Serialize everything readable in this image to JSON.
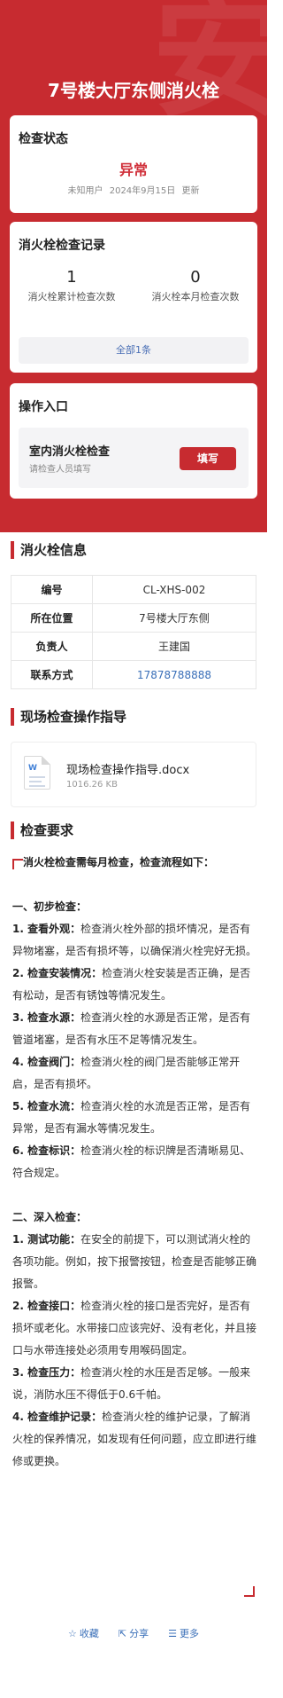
{
  "page": {
    "title": "7号楼大厅东侧消火栓"
  },
  "status": {
    "title": "检查状态",
    "value": "异常",
    "user": "未知用户",
    "date": "2024年9月15日",
    "suffix": "更新"
  },
  "records": {
    "title": "消火栓检查记录",
    "total_count": "1",
    "total_label": "消火栓累计检查次数",
    "month_count": "0",
    "month_label": "消火栓本月检查次数",
    "all_label": "全部1条"
  },
  "actions": {
    "title": "操作入口",
    "item_name": "室内消火栓检查",
    "item_sub": "请检查人员填写",
    "button": "填写"
  },
  "info": {
    "title": "消火栓信息",
    "rows": [
      {
        "key": "编号",
        "value": "CL-XHS-002"
      },
      {
        "key": "所在位置",
        "value": "7号楼大厅东侧"
      },
      {
        "key": "负责人",
        "value": "王建国"
      },
      {
        "key": "联系方式",
        "value": "17878788888"
      }
    ]
  },
  "guide": {
    "title": "现场检查操作指导",
    "file_name": "现场检查操作指导.docx",
    "file_size": "1016.26 KB",
    "file_icon": "word-document-icon"
  },
  "requirements": {
    "title": "检查要求",
    "intro": "消火栓检查需每月检查，检查流程如下：",
    "section1": "一、初步检查：",
    "items1": [
      {
        "label": "1. 查看外观：",
        "text": "检查消火栓外部的损坏情况，是否有异物堵塞，是否有损坏等，以确保消火栓完好无损。"
      },
      {
        "label": "2. 检查安装情况：",
        "text": "检查消火栓安装是否正确，是否有松动，是否有锈蚀等情况发生。"
      },
      {
        "label": "3. 检查水源：",
        "text": "检查消火栓的水源是否正常，是否有管道堵塞，是否有水压不足等情况发生。"
      },
      {
        "label": "4. 检查阀门：",
        "text": "检查消火栓的阀门是否能够正常开启，是否有损坏。"
      },
      {
        "label": "5. 检查水流：",
        "text": "检查消火栓的水流是否正常，是否有异常，是否有漏水等情况发生。"
      },
      {
        "label": "6. 检查标识：",
        "text": "检查消火栓的标识牌是否清晰易见、符合规定。"
      }
    ],
    "section2": "二、深入检查：",
    "items2": [
      {
        "label": "1. 测试功能：",
        "text": "在安全的前提下，可以测试消火栓的各项功能。例如，按下报警按钮，检查是否能够正确报警。"
      },
      {
        "label": "2. 检查接口：",
        "text": "检查消火栓的接口是否完好，是否有损坏或老化。水带接口应该完好、没有老化，并且接口与水带连接处必须用专用喉码固定。"
      },
      {
        "label": "3. 检查压力：",
        "text": "检查消火栓的水压是否足够。一般来说，消防水压不得低于0.6千帕。"
      },
      {
        "label": "4. 检查维护记录：",
        "text": "检查消火栓的维护记录，了解消火栓的保养情况，如发现有任何问题，应立即进行维修或更换。"
      }
    ]
  },
  "footer": {
    "favorite": "收藏",
    "share": "分享",
    "more": "更多"
  },
  "colors": {
    "brand_red": "#c72b30",
    "link_blue": "#3a6fb8"
  }
}
